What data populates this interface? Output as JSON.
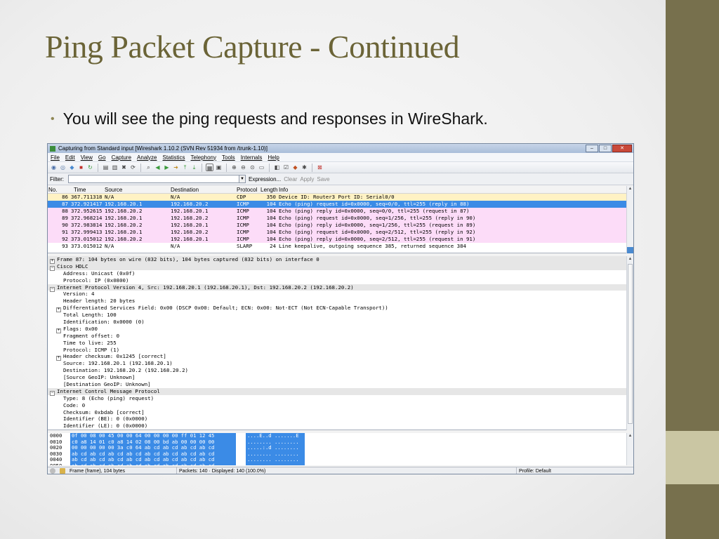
{
  "slide": {
    "title": "Ping Packet Capture - Continued",
    "bullet": "You will see the ping requests and responses in WireShark."
  },
  "window": {
    "title": "Capturing from Standard input   [Wireshark 1.10.2  (SVN Rev 51934 from /trunk-1.10)]",
    "buttons": {
      "minimize": "–",
      "maximize": "□",
      "close": "✕"
    }
  },
  "menu": [
    "File",
    "Edit",
    "View",
    "Go",
    "Capture",
    "Analyze",
    "Statistics",
    "Telephony",
    "Tools",
    "Internals",
    "Help"
  ],
  "filter": {
    "label": "Filter:",
    "value": "",
    "expression": "Expression...",
    "clear": "Clear",
    "apply": "Apply",
    "save": "Save"
  },
  "packet_list": {
    "columns": {
      "no": "No.",
      "time": "Time",
      "source": "Source",
      "destination": "Destination",
      "protocol": "Protocol",
      "length": "Length",
      "info": "Info"
    },
    "rows": [
      {
        "no": "86",
        "time": "367.711318",
        "source": "N/A",
        "destination": "N/A",
        "protocol": "CDP",
        "length": "350",
        "info": "Device ID: Router3   Port ID: Serial0/0",
        "kind": "cdp"
      },
      {
        "no": "87",
        "time": "372.921417",
        "source": "192.168.20.1",
        "destination": "192.168.20.2",
        "protocol": "ICMP",
        "length": "104",
        "info": "Echo (ping) request  id=0x0000, seq=0/0, ttl=255 (reply in 88)",
        "kind": "sel"
      },
      {
        "no": "88",
        "time": "372.952615",
        "source": "192.168.20.2",
        "destination": "192.168.20.1",
        "protocol": "ICMP",
        "length": "104",
        "info": "Echo (ping) reply    id=0x0000, seq=0/0, ttl=255 (request in 87)",
        "kind": "icmp"
      },
      {
        "no": "89",
        "time": "372.968214",
        "source": "192.168.20.1",
        "destination": "192.168.20.2",
        "protocol": "ICMP",
        "length": "104",
        "info": "Echo (ping) request  id=0x0000, seq=1/256, ttl=255 (reply in 90)",
        "kind": "icmp"
      },
      {
        "no": "90",
        "time": "372.983814",
        "source": "192.168.20.2",
        "destination": "192.168.20.1",
        "protocol": "ICMP",
        "length": "104",
        "info": "Echo (ping) reply    id=0x0000, seq=1/256, ttl=255 (request in 89)",
        "kind": "icmp"
      },
      {
        "no": "91",
        "time": "372.999413",
        "source": "192.168.20.1",
        "destination": "192.168.20.2",
        "protocol": "ICMP",
        "length": "104",
        "info": "Echo (ping) request  id=0x0000, seq=2/512, ttl=255 (reply in 92)",
        "kind": "icmp"
      },
      {
        "no": "92",
        "time": "373.015012",
        "source": "192.168.20.2",
        "destination": "192.168.20.1",
        "protocol": "ICMP",
        "length": "104",
        "info": "Echo (ping) reply    id=0x0000, seq=2/512, ttl=255 (request in 91)",
        "kind": "icmp"
      },
      {
        "no": "93",
        "time": "373.015012",
        "source": "N/A",
        "destination": "N/A",
        "protocol": "SLARP",
        "length": "24",
        "info": "Line keepalive, outgoing sequence 385, returned sequence 384",
        "kind": "slarp"
      }
    ]
  },
  "details": [
    {
      "text": "Frame 87: 104 bytes on wire (832 bits), 104 bytes captured (832 bits) on interface 0",
      "level": 0,
      "exp": "+"
    },
    {
      "text": "Cisco HDLC",
      "level": 0,
      "exp": "-"
    },
    {
      "text": "Address: Unicast (0x0f)",
      "level": 1,
      "exp": ""
    },
    {
      "text": "Protocol: IP (0x0800)",
      "level": 1,
      "exp": ""
    },
    {
      "text": "Internet Protocol Version 4, Src: 192.168.20.1 (192.168.20.1), Dst: 192.168.20.2 (192.168.20.2)",
      "level": 0,
      "exp": "-"
    },
    {
      "text": "Version: 4",
      "level": 1,
      "exp": ""
    },
    {
      "text": "Header length: 20 bytes",
      "level": 1,
      "exp": ""
    },
    {
      "text": "Differentiated Services Field: 0x00 (DSCP 0x00: Default; ECN: 0x00: Not-ECT (Not ECN-Capable Transport))",
      "level": 1,
      "exp": "+"
    },
    {
      "text": "Total Length: 100",
      "level": 1,
      "exp": ""
    },
    {
      "text": "Identification: 0x0000 (0)",
      "level": 1,
      "exp": ""
    },
    {
      "text": "Flags: 0x00",
      "level": 1,
      "exp": "+"
    },
    {
      "text": "Fragment offset: 0",
      "level": 1,
      "exp": ""
    },
    {
      "text": "Time to live: 255",
      "level": 1,
      "exp": ""
    },
    {
      "text": "Protocol: ICMP (1)",
      "level": 1,
      "exp": ""
    },
    {
      "text": "Header checksum: 0x1245 [correct]",
      "level": 1,
      "exp": "+"
    },
    {
      "text": "Source: 192.168.20.1 (192.168.20.1)",
      "level": 1,
      "exp": ""
    },
    {
      "text": "Destination: 192.168.20.2 (192.168.20.2)",
      "level": 1,
      "exp": ""
    },
    {
      "text": "[Source GeoIP: Unknown]",
      "level": 1,
      "exp": ""
    },
    {
      "text": "[Destination GeoIP: Unknown]",
      "level": 1,
      "exp": ""
    },
    {
      "text": "Internet Control Message Protocol",
      "level": 0,
      "exp": "-"
    },
    {
      "text": "Type: 8 (Echo (ping) request)",
      "level": 1,
      "exp": ""
    },
    {
      "text": "Code: 0",
      "level": 1,
      "exp": ""
    },
    {
      "text": "Checksum: 0xbdab [correct]",
      "level": 1,
      "exp": ""
    },
    {
      "text": "Identifier (BE): 0 (0x0000)",
      "level": 1,
      "exp": ""
    },
    {
      "text": "Identifier (LE): 0 (0x0000)",
      "level": 1,
      "exp": ""
    }
  ],
  "hex": [
    {
      "offset": "0000",
      "bytes": "0f 00 08 00 45 00 00 64  00 00 00 00 ff 01 12 45",
      "ascii": "....E..d .......E"
    },
    {
      "offset": "0010",
      "bytes": "c0 a8 14 01 c0 a8 14 02  08 00 bd ab 00 00 00 00",
      "ascii": "........ ........"
    },
    {
      "offset": "0020",
      "bytes": "00 00 00 00 00 3a c0 64  ab cd ab cd ab cd ab cd",
      "ascii": ".....:.d ........"
    },
    {
      "offset": "0030",
      "bytes": "ab cd ab cd ab cd ab cd  ab cd ab cd ab cd ab cd",
      "ascii": "........ ........"
    },
    {
      "offset": "0040",
      "bytes": "ab cd ab cd ab cd ab cd  ab cd ab cd ab cd ab cd",
      "ascii": "........ ........"
    },
    {
      "offset": "0050",
      "bytes": "ab cd ab cd ab cd ab cd  ab cd ab cd ab cd ab cd",
      "ascii": "........ ........"
    }
  ],
  "status": {
    "frame": "Frame (frame), 104 bytes",
    "packets": "Packets: 140 · Displayed: 140 (100.0%)",
    "profile": "Profile: Default"
  },
  "colors": {
    "selected": "#3b8be6",
    "icmp": "#fcdcf8",
    "cdp": "#fff2c4",
    "title": "#6b6437",
    "sidebar": "#77704d"
  }
}
